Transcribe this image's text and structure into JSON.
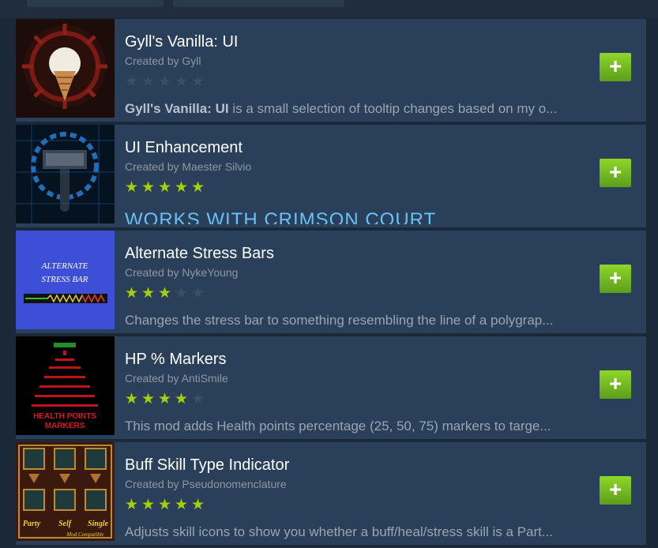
{
  "items": [
    {
      "title": "Gyll's Vanilla: UI",
      "author": "Created by Gyll",
      "rating": 0,
      "desc_bold": "Gyll's Vanilla: UI",
      "desc": " is a small selection of tooltip changes based on my o...",
      "add_label": "+"
    },
    {
      "title": "UI Enhancement",
      "author": "Created by Maester Silvio",
      "rating": 5,
      "desc": "WORKS WITH CRIMSON COURT",
      "add_label": "+"
    },
    {
      "title": "Alternate Stress Bars",
      "author": "Created by NykeYoung",
      "rating": 3,
      "desc": "Changes the stress bar to something resembling the line of a polygrap...",
      "thumb_text": [
        "ALTERNATE",
        "STRESS BAR"
      ],
      "add_label": "+"
    },
    {
      "title": "HP % Markers",
      "author": "Created by AntiSmile",
      "rating": 4,
      "desc": "This mod adds Health points percentage (25, 50, 75) markers to targe...",
      "thumb_text": [
        "HEALTH POINTS",
        "MARKERS"
      ],
      "add_label": "+"
    },
    {
      "title": "Buff Skill Type Indicator",
      "author": "Created by Pseudonomenclature",
      "rating": 5,
      "desc": "Adjusts skill icons to show you whether a buff/heal/stress skill is a Part...",
      "thumb_text": [
        "Party",
        "Self",
        "Single",
        "Mod Compatible"
      ],
      "add_label": "+"
    }
  ],
  "colors": {
    "accent_green": "#a4d007",
    "bg": "#1b2838",
    "row": "#2a3f5a",
    "link_blue": "#67c1f5"
  },
  "icons": [
    "star-icon",
    "plus-icon"
  ]
}
